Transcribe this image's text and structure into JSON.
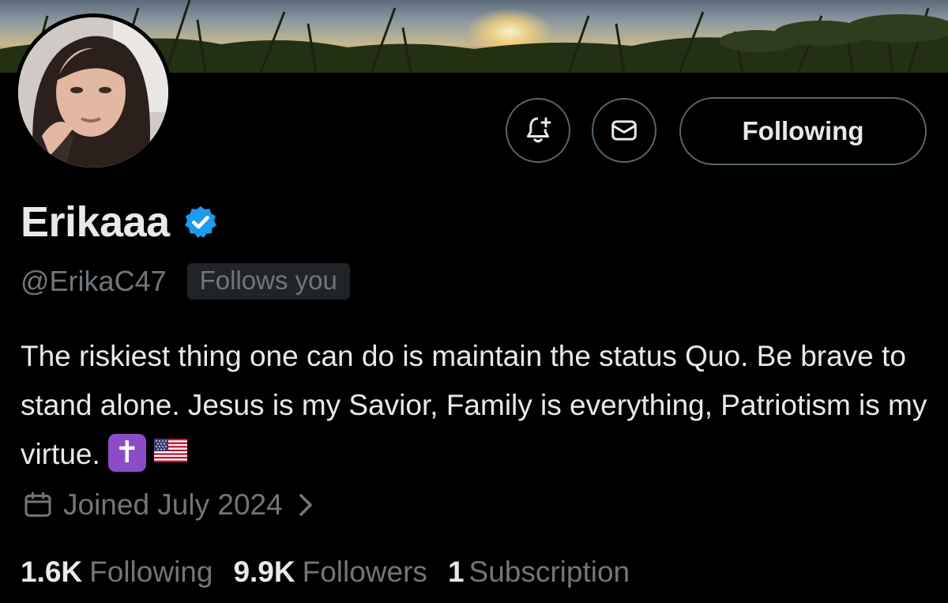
{
  "profile": {
    "display_name": "Erikaaa",
    "handle": "@ErikaC47",
    "follows_you": "Follows you",
    "bio": "The riskiest thing one can do is maintain the status Quo. Be brave to stand alone. Jesus is my Savior, Family is everything, Patriotism is my virtue.",
    "bio_cross_emoji": "✝",
    "joined": "Joined July 2024"
  },
  "actions": {
    "notify_icon": "bell-plus-icon",
    "message_icon": "envelope-icon",
    "follow_label": "Following"
  },
  "stats": {
    "following_count": "1.6K",
    "following_label": "Following",
    "followers_count": "9.9K",
    "followers_label": "Followers",
    "subscriptions_count": "1",
    "subscriptions_label": "Subscription"
  },
  "colors": {
    "background": "#000000",
    "text_primary": "#e7e9ea",
    "text_secondary": "#71767b",
    "verified_badge": "#1d9bf0",
    "button_border": "#536471"
  }
}
